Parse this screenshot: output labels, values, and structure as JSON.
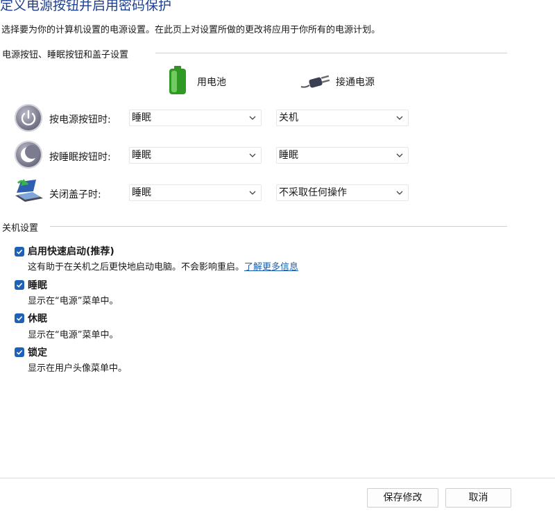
{
  "page": {
    "title": "定义电源按钮并启用密码保护",
    "subtitle": "选择要为你的计算机设置的电源设置。在此页上对设置所做的更改将应用于你所有的电源计划。"
  },
  "power_section": {
    "heading": "电源按钮、睡眠按钮和盖子设置",
    "columns": {
      "battery": "用电池",
      "plugged_in": "接通电源"
    },
    "rows": [
      {
        "label": "按电源按钮时:",
        "battery": "睡眠",
        "plugged_in": "关机",
        "icon": "power-button-icon"
      },
      {
        "label": "按睡眠按钮时:",
        "battery": "睡眠",
        "plugged_in": "睡眠",
        "icon": "sleep-button-icon"
      },
      {
        "label": "关闭盖子时:",
        "battery": "睡眠",
        "plugged_in": "不采取任何操作",
        "icon": "laptop-lid-icon"
      }
    ]
  },
  "shutdown_section": {
    "heading": "关机设置",
    "options": [
      {
        "title": "启用快速启动(推荐)",
        "desc": "这有助于在关机之后更快地启动电脑。不会影响重启。",
        "link": "了解更多信息",
        "checked": true
      },
      {
        "title": "睡眠",
        "desc": "显示在“电源”菜单中。",
        "checked": true
      },
      {
        "title": "休眠",
        "desc": "显示在“电源”菜单中。",
        "checked": true
      },
      {
        "title": "锁定",
        "desc": "显示在用户头像菜单中。",
        "checked": true
      }
    ]
  },
  "footer": {
    "save": "保存修改",
    "cancel": "取消"
  },
  "colors": {
    "title": "#1e3f8f",
    "accent": "#1f61b6",
    "link": "#1a5fb4"
  }
}
